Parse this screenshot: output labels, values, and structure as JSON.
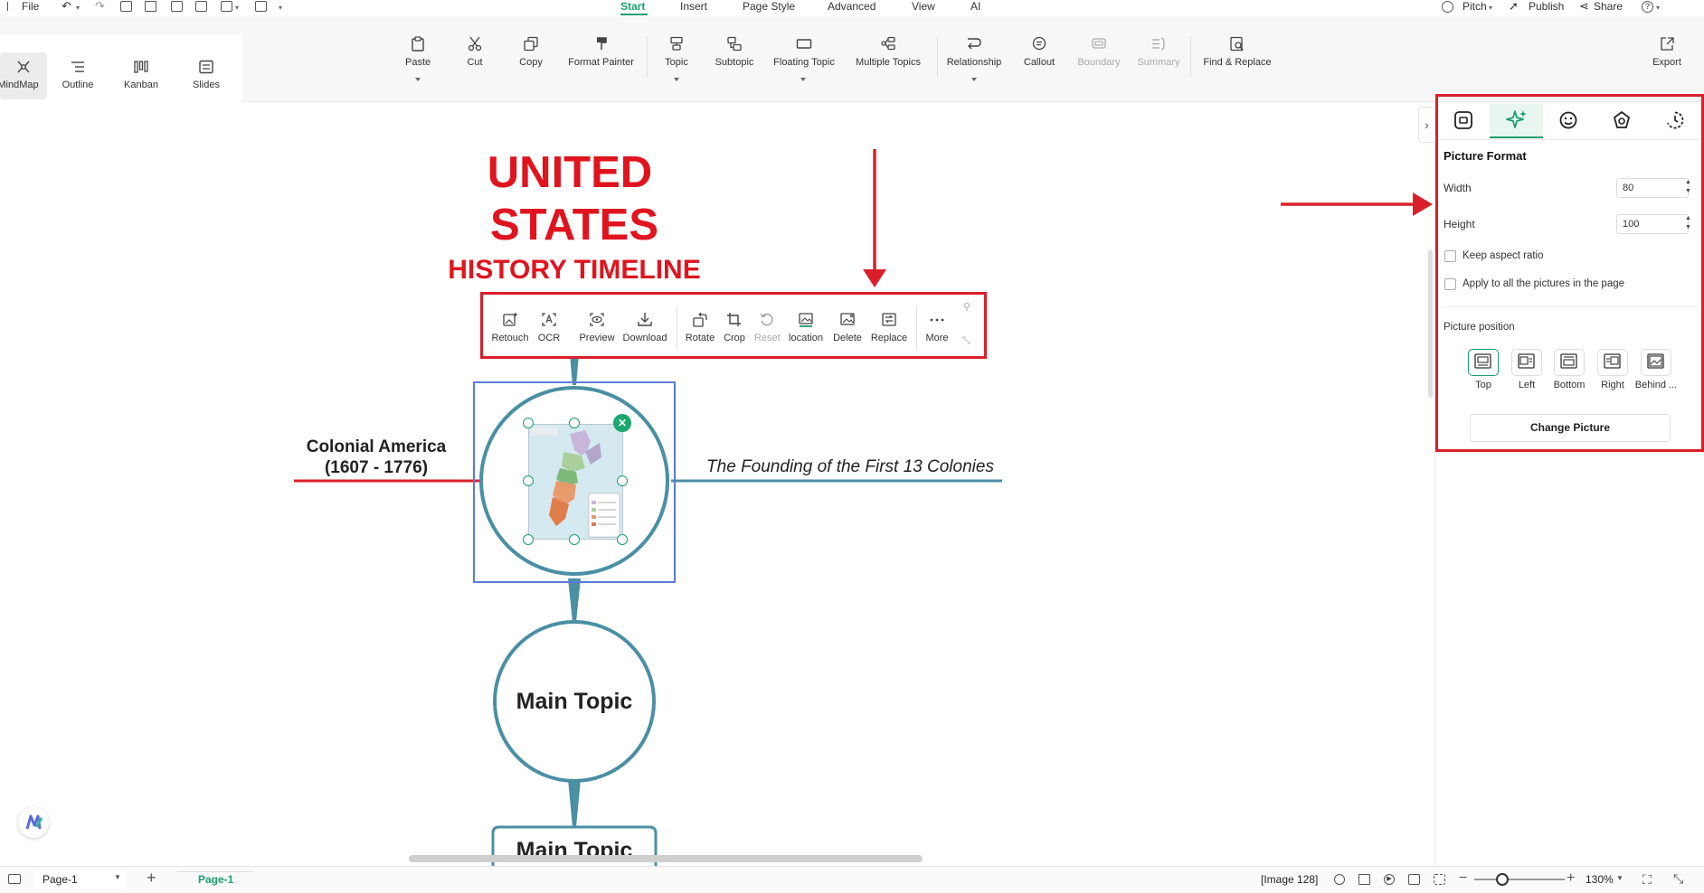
{
  "menubar": {
    "file": "File",
    "tabs": [
      "Start",
      "Insert",
      "Page Style",
      "Advanced",
      "View",
      "AI"
    ],
    "right": {
      "pitch": "Pitch",
      "publish": "Publish",
      "share": "Share"
    }
  },
  "views": [
    "MindMap",
    "Outline",
    "Kanban",
    "Slides"
  ],
  "ribbon": {
    "paste": "Paste",
    "cut": "Cut",
    "copy": "Copy",
    "format_painter": "Format Painter",
    "topic": "Topic",
    "subtopic": "Subtopic",
    "floating_topic": "Floating Topic",
    "multiple_topics": "Multiple Topics",
    "relationship": "Relationship",
    "callout": "Callout",
    "boundary": "Boundary",
    "summary": "Summary",
    "find_replace": "Find & Replace",
    "export": "Export"
  },
  "canvas": {
    "title_line1": "UNITED",
    "title_line2": "STATES",
    "title_line3": "HISTORY TIMELINE",
    "left_topic_line1": "Colonial America",
    "left_topic_line2": "(1607 - 1776)",
    "right_topic": "The Founding of the First 13 Colonies",
    "main_topic_1": "Main Topic",
    "main_topic_2": "Main Topic"
  },
  "image_toolbar": [
    "Retouch",
    "OCR",
    "Preview",
    "Download",
    "Rotate",
    "Crop",
    "Reset",
    "location",
    "Delete",
    "Replace",
    "More"
  ],
  "panel": {
    "title": "Picture Format",
    "width_label": "Width",
    "width_value": "80",
    "height_label": "Height",
    "height_value": "100",
    "keep_aspect": "Keep aspect ratio",
    "apply_all": "Apply to all the pictures in the page",
    "position_title": "Picture position",
    "positions": [
      "Top",
      "Left",
      "Bottom",
      "Right",
      "Behind ..."
    ],
    "change_picture": "Change Picture"
  },
  "statusbar": {
    "page_select": "Page-1",
    "page_tab": "Page-1",
    "image_info": "[Image 128]",
    "zoom": "130%"
  },
  "colors": {
    "accent": "#1a9e6e",
    "annotation_red": "#d9202a",
    "title_red": "#e0141e",
    "topic_stroke": "#4a8fa3"
  }
}
